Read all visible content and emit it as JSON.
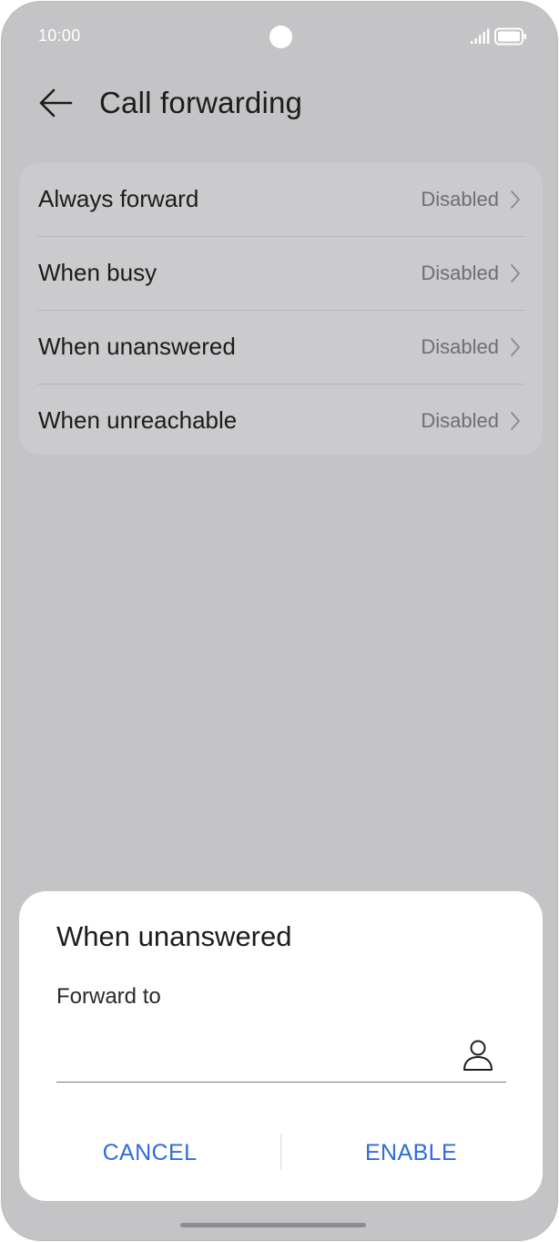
{
  "status_bar": {
    "time": "10:00",
    "signal_icon": "signal-bars-icon",
    "battery_icon": "battery-full-icon"
  },
  "header": {
    "back_icon": "arrow-left-icon",
    "title": "Call forwarding"
  },
  "settings": {
    "items": [
      {
        "label": "Always forward",
        "value": "Disabled",
        "icon": "chevron-right-icon"
      },
      {
        "label": "When busy",
        "value": "Disabled",
        "icon": "chevron-right-icon"
      },
      {
        "label": "When unanswered",
        "value": "Disabled",
        "icon": "chevron-right-icon"
      },
      {
        "label": "When unreachable",
        "value": "Disabled",
        "icon": "chevron-right-icon"
      }
    ]
  },
  "dialog": {
    "title": "When unanswered",
    "field_label": "Forward to",
    "field_value": "",
    "contact_icon": "person-icon",
    "cancel_label": "CANCEL",
    "enable_label": "ENABLE"
  },
  "colors": {
    "accent": "#2f6cde",
    "background_dim": "#c4c4c7",
    "card": "#cbcbce",
    "dialog": "#ffffff"
  }
}
